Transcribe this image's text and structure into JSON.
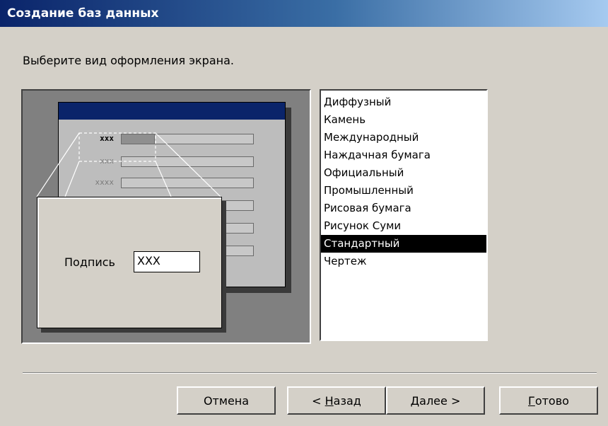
{
  "window": {
    "title": "Создание баз данных"
  },
  "instruction": "Выберите вид оформления экрана.",
  "preview": {
    "field_labels": [
      "xxx",
      "xxx",
      "xxxx"
    ],
    "zoom_caption": "Подпись",
    "zoom_value": "XXX"
  },
  "styles": {
    "items": [
      "Диффузный",
      "Камень",
      "Международный",
      "Наждачная бумага",
      "Официальный",
      "Промышленный",
      "Рисовая бумага",
      "Рисунок Суми",
      "Стандартный",
      "Чертеж"
    ],
    "selected": "Стандартный"
  },
  "buttons": {
    "cancel": "Отмена",
    "back_prefix": "< ",
    "back_accel": "Н",
    "back_rest": "азад",
    "next_accel": "Д",
    "next_rest": "алее >",
    "finish_accel": "Г",
    "finish_rest": "отово"
  },
  "colors": {
    "titlebar_start": "#0a246a",
    "titlebar_end": "#a6caf0",
    "dialog_bg": "#d4d0c8",
    "selection": "#000000"
  }
}
